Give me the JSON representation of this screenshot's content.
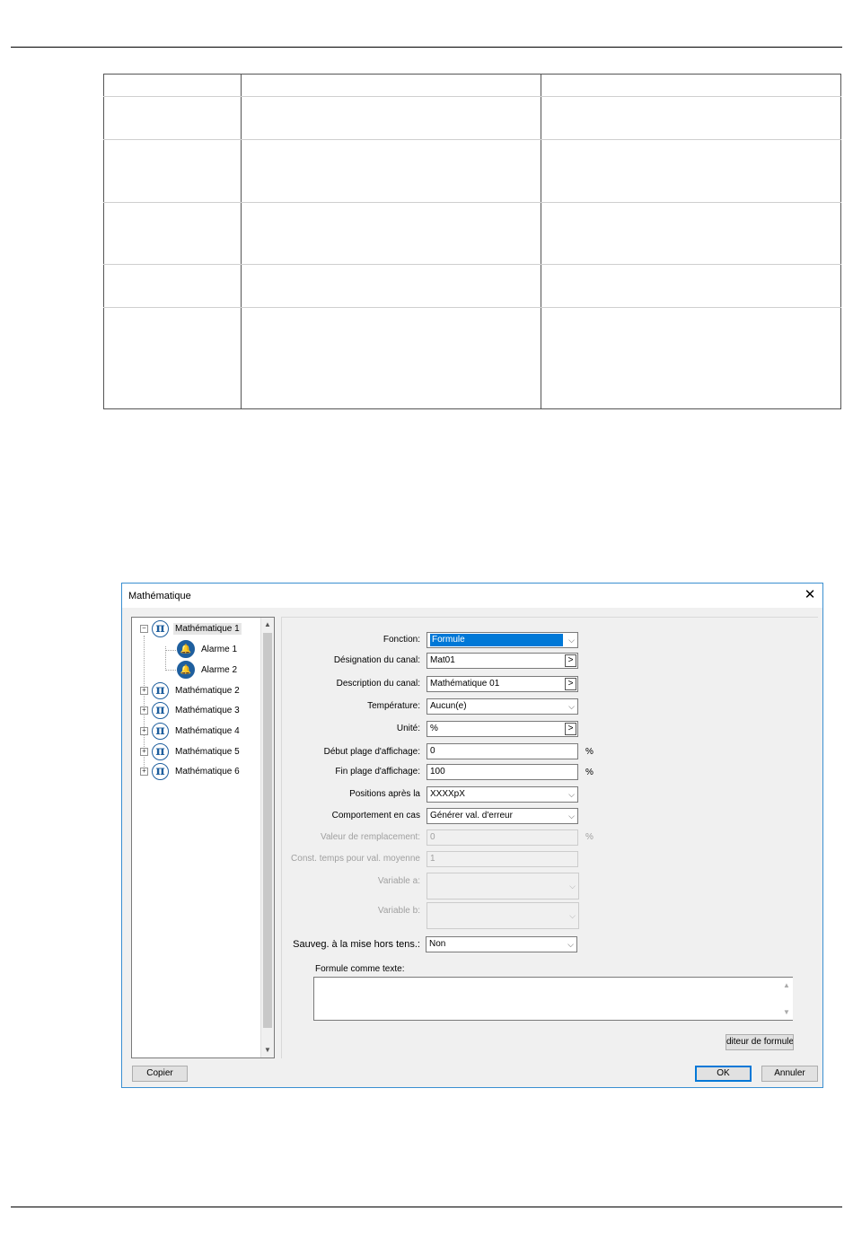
{
  "dialog": {
    "title": "Mathématique",
    "close_glyph": "✕"
  },
  "tree": {
    "items": [
      {
        "label": "Mathématique 1",
        "expander": "−",
        "icon": "pi-icon"
      },
      {
        "label": "Alarme 1",
        "icon": "alarm-bell-icon"
      },
      {
        "label": "Alarme 2",
        "icon": "alarm-bell-icon"
      },
      {
        "label": "Mathématique 2",
        "expander": "+",
        "icon": "pi-icon"
      },
      {
        "label": "Mathématique 3",
        "expander": "+",
        "icon": "pi-icon"
      },
      {
        "label": "Mathématique 4",
        "expander": "+",
        "icon": "pi-icon"
      },
      {
        "label": "Mathématique 5",
        "expander": "+",
        "icon": "pi-icon"
      },
      {
        "label": "Mathématique 6",
        "expander": "+",
        "icon": "pi-icon"
      }
    ],
    "pi_glyph": "π",
    "bell_glyph": "🔔",
    "scroll_up": "▲",
    "scroll_down": "▼"
  },
  "form": {
    "fonction": {
      "label": "Fonction:",
      "value": "Formule"
    },
    "designation": {
      "label": "Désignation du canal:",
      "value": "Mat01",
      "more": ">"
    },
    "description": {
      "label": "Description du canal:",
      "value": "Mathématique 01",
      "more": ">"
    },
    "temperature": {
      "label": "Température:",
      "value": "Aucun(e)"
    },
    "unite": {
      "label": "Unité:",
      "value": "%",
      "more": ">"
    },
    "debut": {
      "label": "Début plage d'affichage:",
      "value": "0",
      "unit": "%"
    },
    "fin": {
      "label": "Fin plage d'affichage:",
      "value": "100",
      "unit": "%"
    },
    "positions": {
      "label": "Positions après la",
      "value": "XXXXpX"
    },
    "comportement": {
      "label": "Comportement en cas",
      "value": "Générer val. d'erreur"
    },
    "valeur_remplacement": {
      "label": "Valeur de remplacement:",
      "value": "0",
      "unit": "%"
    },
    "const_temps": {
      "label": "Const. temps pour val. moyenne",
      "value": "1"
    },
    "variable_a": {
      "label": "Variable a:"
    },
    "variable_b": {
      "label": "Variable b:"
    },
    "sauveg": {
      "label": "Sauveg. à la mise hors tens.:",
      "value": "Non"
    },
    "formule_texte": {
      "label": "Formule comme texte:"
    },
    "dropdown_glyph": "⌵"
  },
  "buttons": {
    "editeur": "diteur de formule:",
    "copier": "Copier",
    "ok": "OK",
    "annuler": "Annuler"
  }
}
